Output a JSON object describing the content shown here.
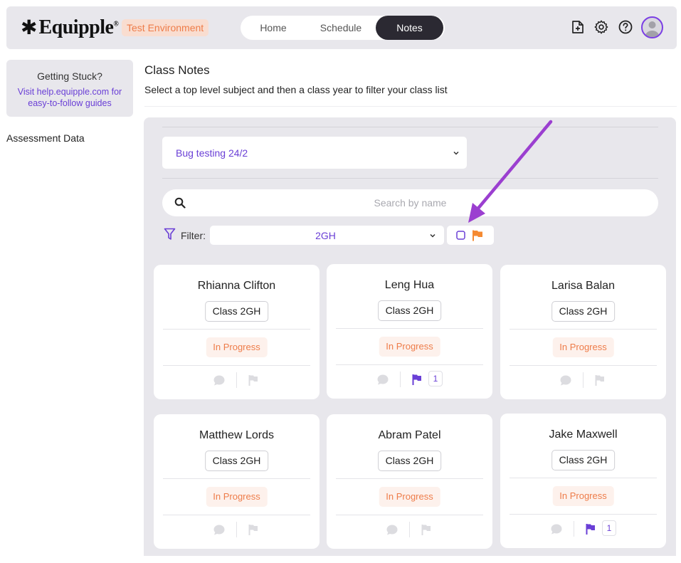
{
  "header": {
    "logo_mark": "✱",
    "logo_text": "Equipple",
    "logo_reg": "®",
    "env_badge": "Test Environment",
    "tabs": [
      {
        "label": "Home"
      },
      {
        "label": "Schedule"
      },
      {
        "label": "Notes",
        "active": true
      }
    ],
    "icons": [
      "add-document-icon",
      "gear-icon",
      "help-icon",
      "avatar"
    ]
  },
  "sidebar": {
    "help_title": "Getting Stuck?",
    "help_link": "Visit help.equipple.com for easy-to-follow guides",
    "items": [
      {
        "label": "Assessment Data"
      }
    ]
  },
  "main": {
    "title": "Class Notes",
    "subtitle": "Select a top level subject and then a class year to filter your class list",
    "subject_select": "Bug testing 24/2",
    "search_placeholder": "Search by name",
    "filter_label": "Filter:",
    "filter_value": "2GH",
    "flag_filter_checked": false
  },
  "students": [
    {
      "name": "Rhianna Clifton",
      "class": "Class 2GH",
      "status": "In Progress",
      "flagged": false,
      "flag_count": ""
    },
    {
      "name": "Leng Hua",
      "class": "Class 2GH",
      "status": "In Progress",
      "flagged": true,
      "flag_count": "1"
    },
    {
      "name": "Larisa Balan",
      "class": "Class 2GH",
      "status": "In Progress",
      "flagged": false,
      "flag_count": ""
    },
    {
      "name": "Matthew Lords",
      "class": "Class 2GH",
      "status": "In Progress",
      "flagged": false,
      "flag_count": ""
    },
    {
      "name": "Abram Patel",
      "class": "Class 2GH",
      "status": "In Progress",
      "flagged": false,
      "flag_count": ""
    },
    {
      "name": "Jake Maxwell",
      "class": "Class 2GH",
      "status": "In Progress",
      "flagged": true,
      "flag_count": "1"
    }
  ],
  "colors": {
    "accent": "#6a3fd6",
    "flag_orange": "#f58a32",
    "status_orange": "#ee7c49",
    "annotation_arrow": "#9b3fd0"
  }
}
